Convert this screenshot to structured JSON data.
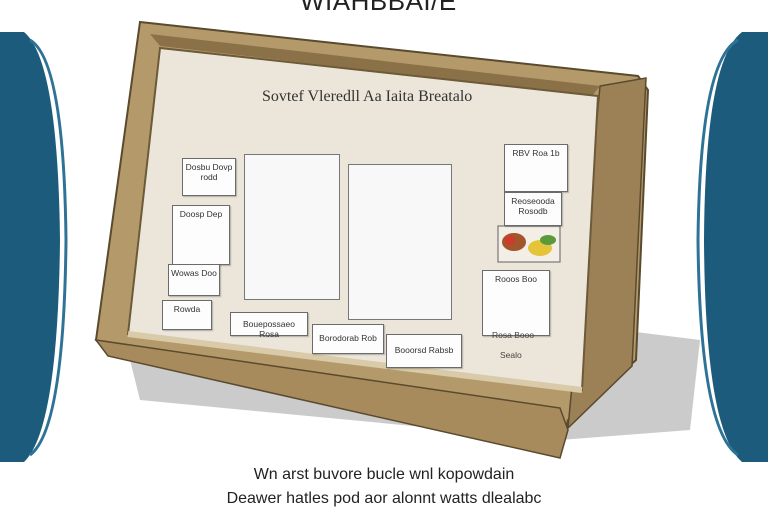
{
  "header": {
    "title": "WIAHBBAI/E"
  },
  "board": {
    "title": "Sovtef Vleredll Aa Iaita Breatalo",
    "left_cards": [
      "Dosbu Dovp\nrodd",
      "Doosp Dep",
      "Wowas Doo",
      "Rowda"
    ],
    "bottom_cards": [
      "Bouepossaeo Rosa",
      "Borodorab Rob",
      "Booorsd Rabsb"
    ],
    "right_cards": [
      "RBV Roa 1b",
      "Reoseooda Rosodb",
      "Rooos Boo",
      "Rosa Booo"
    ],
    "right_note": "Sealo"
  },
  "caption": {
    "line1": "Wn arst buvore bucle wnl kopowdain",
    "line2": "Deawer hatles pod aor alonnt watts dlealabc"
  },
  "colors": {
    "frame": "#b49a6b",
    "frame_dark": "#8a7148",
    "cork": "#ece6da",
    "side_blue": "#1d5b7c"
  }
}
